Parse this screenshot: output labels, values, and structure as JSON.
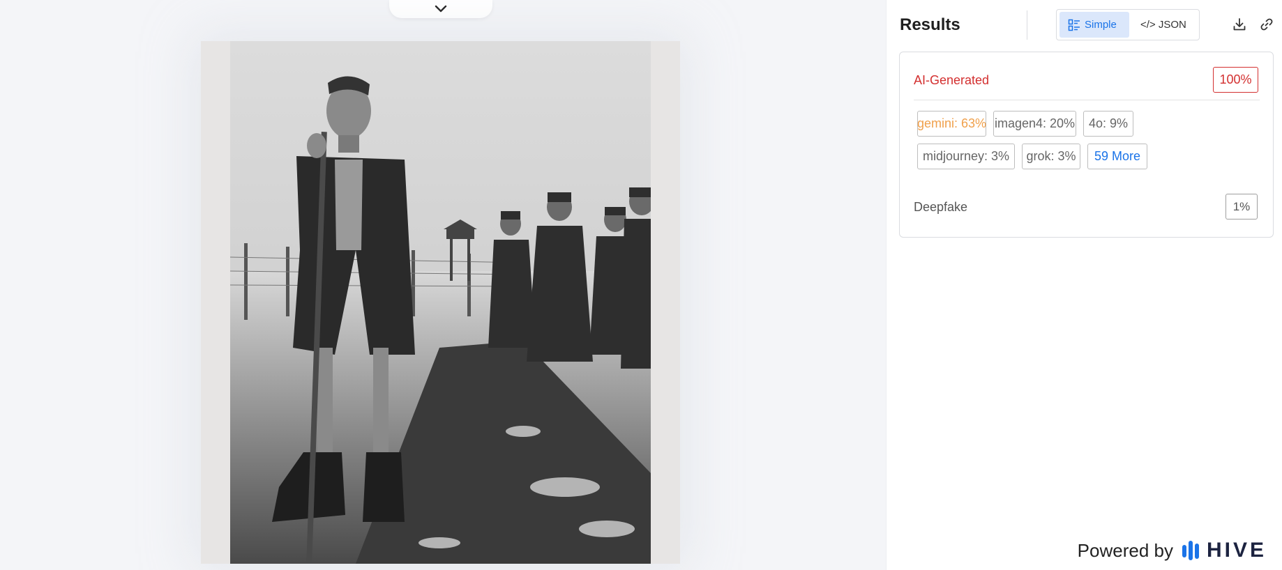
{
  "preview": {
    "collapse_icon": "chevron-down-icon",
    "image_alt": "Black and white photo of an emaciated man with a walking stick in front of soldiers on a snowy path"
  },
  "results": {
    "title": "Results",
    "toggle": {
      "simple_label": "Simple",
      "simple_icon": "list-view-icon",
      "json_label": "</> JSON"
    },
    "download_icon": "download-icon",
    "link_icon": "link-icon"
  },
  "ai_generated": {
    "label": "AI-Generated",
    "score": "100%",
    "sources": [
      {
        "text": "gemini: 63%",
        "color": "#f0a04b"
      },
      {
        "text": "imagen4: 20%"
      },
      {
        "text": "4o: 9%"
      },
      {
        "text": "midjourney: 3%"
      },
      {
        "text": "grok: 3%"
      },
      {
        "text": "59 More",
        "color": "#1a73e8"
      }
    ]
  },
  "deepfake": {
    "label": "Deepfake",
    "score": "1%"
  },
  "footer": {
    "powered_by": "Powered by",
    "brand": "HIVE"
  },
  "colors": {
    "accent": "#1a73e8",
    "danger": "#d32f2f",
    "highlight": "#f0a04b"
  }
}
